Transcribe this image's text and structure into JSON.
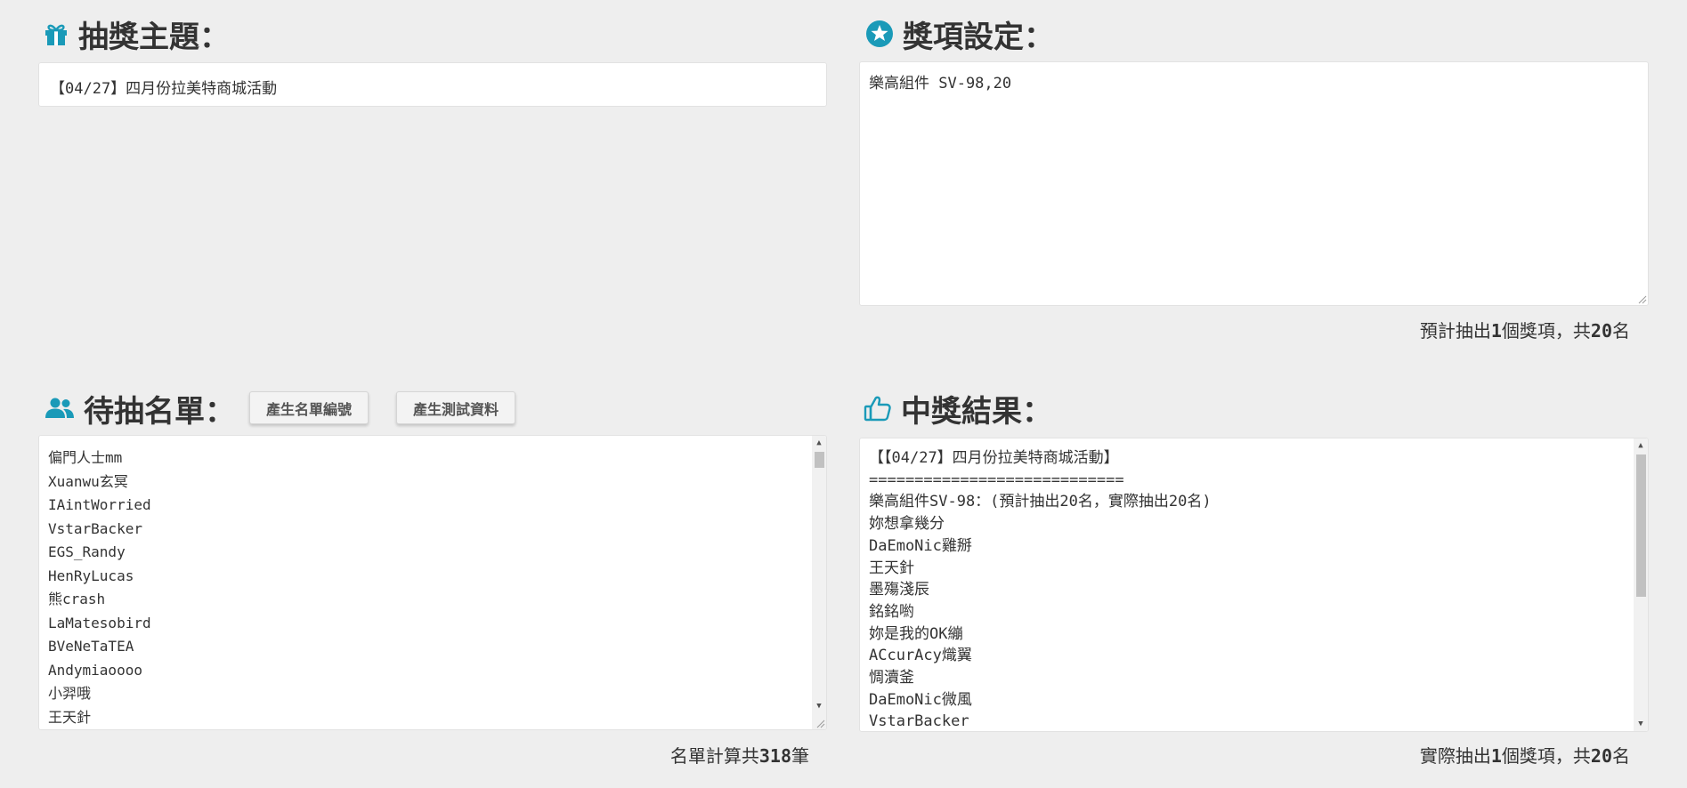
{
  "theme": {
    "title": "抽獎主題：",
    "value": "【04/27】四月份拉美特商城活動"
  },
  "prizes": {
    "title": "獎項設定：",
    "lines": [
      "樂高組件 SV-98,20"
    ],
    "summary_prefix": "預計抽出",
    "summary_count": "1",
    "summary_mid": "個獎項，共",
    "summary_total": "20",
    "summary_suffix": "名"
  },
  "candidates": {
    "title": "待抽名單：",
    "btn_number": "產生名單編號",
    "btn_test": "產生測試資料",
    "lines": [
      "偏門人士mm",
      "Xuanwu玄冥",
      "IAintWorried",
      "VstarBacker",
      "EGS_Randy",
      "HenRyLucas",
      "熊crash",
      "LaMatesobird",
      "BVeNeTaTEA",
      "Andymiaoooo",
      "小羿哦",
      "王天針"
    ],
    "summary_prefix": "名單計算共",
    "summary_count": "318",
    "summary_suffix": "筆"
  },
  "results": {
    "title": "中獎結果：",
    "lines": [
      "【【04/27】四月份拉美特商城活動】",
      "============================",
      "樂高組件SV-98：(預計抽出20名，實際抽出20名)",
      "妳想拿幾分",
      "DaEmoNic雞掰",
      "王天針",
      "墨殤淺辰",
      "銘銘喲",
      "妳是我的OK繃",
      "ACcurAcy熾翼",
      "惆瀆釜",
      "DaEmoNic微風",
      "VstarBacker"
    ],
    "summary_prefix": "實際抽出",
    "summary_count": "1",
    "summary_mid": "個獎項，共",
    "summary_total": "20",
    "summary_suffix": "名"
  },
  "colors": {
    "accent": "#1a9ab8",
    "background": "#eeeeee"
  },
  "icons": {
    "theme": "gift-icon",
    "prizes": "star-icon",
    "candidates": "users-icon",
    "results": "thumbs-up-icon"
  }
}
